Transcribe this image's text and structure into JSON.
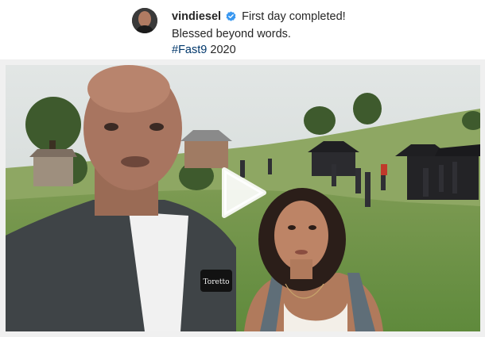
{
  "post": {
    "username": "vindiesel",
    "caption_line1": "First day completed!",
    "caption_line2": "Blessed beyond words.",
    "hashtag": "#Fast9",
    "year": "2020"
  },
  "media": {
    "type": "video",
    "patch_text": "Toretto",
    "play_icon": "play-icon"
  },
  "colors": {
    "verified_badge": "#3897f0",
    "hashtag": "#00376b",
    "text": "#262626"
  }
}
